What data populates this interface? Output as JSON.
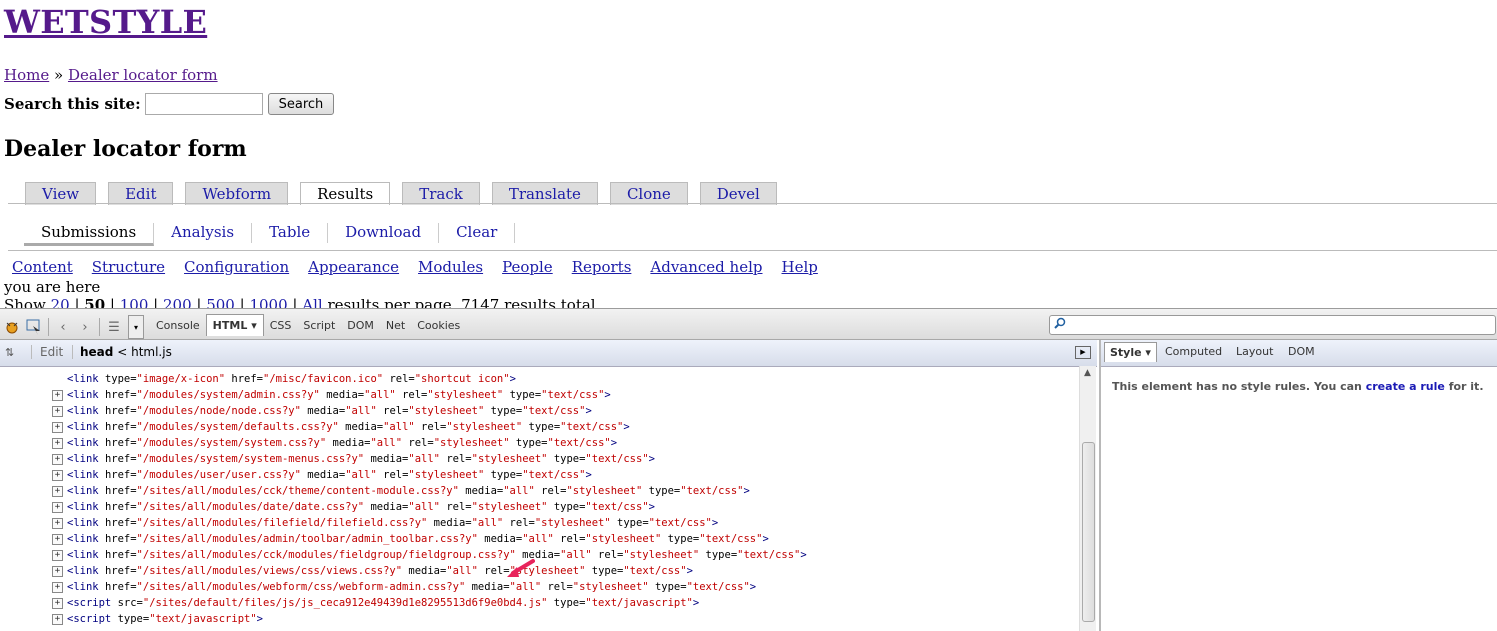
{
  "site": {
    "logo": "WETSTYLE",
    "breadcrumb": {
      "home": "Home",
      "sep": "»",
      "current": "Dealer locator form"
    },
    "search": {
      "label": "Search this site:",
      "value": "",
      "button": "Search"
    },
    "page_title": "Dealer locator form",
    "tabs": [
      "View",
      "Edit",
      "Webform",
      "Results",
      "Track",
      "Translate",
      "Clone",
      "Devel"
    ],
    "subtabs": [
      "Submissions",
      "Analysis",
      "Table",
      "Download",
      "Clear"
    ],
    "admin_menu": [
      "Content",
      "Structure",
      "Configuration",
      "Appearance",
      "Modules",
      "People",
      "Reports",
      "Advanced help",
      "Help"
    ],
    "you_are_here": "you are here",
    "pager": {
      "show": "Show",
      "options": [
        "20",
        "50",
        "100",
        "200",
        "500",
        "1000",
        "All"
      ],
      "suffix": "results per page. 7147 results total"
    }
  },
  "firebug": {
    "panels": [
      "Console",
      "HTML",
      "CSS",
      "Script",
      "DOM",
      "Net",
      "Cookies"
    ],
    "active_panel": "HTML",
    "breadcrumb": {
      "edit": "Edit",
      "current": "head",
      "sep": "<",
      "parent": "html.js"
    },
    "side_tabs": [
      "Style",
      "Computed",
      "Layout",
      "DOM"
    ],
    "side_message": {
      "before": "This element has no style rules. You can ",
      "link": "create a rule",
      "after": " for it."
    },
    "lines": [
      {
        "tag": "link",
        "expand": false,
        "attrs": [
          [
            "type",
            "image/x-icon"
          ],
          [
            "href",
            "/misc/favicon.ico"
          ],
          [
            "rel",
            "shortcut icon"
          ]
        ]
      },
      {
        "tag": "link",
        "expand": true,
        "attrs": [
          [
            "href",
            "/modules/system/admin.css?y"
          ],
          [
            "media",
            "all"
          ],
          [
            "rel",
            "stylesheet"
          ],
          [
            "type",
            "text/css"
          ]
        ]
      },
      {
        "tag": "link",
        "expand": true,
        "attrs": [
          [
            "href",
            "/modules/node/node.css?y"
          ],
          [
            "media",
            "all"
          ],
          [
            "rel",
            "stylesheet"
          ],
          [
            "type",
            "text/css"
          ]
        ]
      },
      {
        "tag": "link",
        "expand": true,
        "attrs": [
          [
            "href",
            "/modules/system/defaults.css?y"
          ],
          [
            "media",
            "all"
          ],
          [
            "rel",
            "stylesheet"
          ],
          [
            "type",
            "text/css"
          ]
        ]
      },
      {
        "tag": "link",
        "expand": true,
        "attrs": [
          [
            "href",
            "/modules/system/system.css?y"
          ],
          [
            "media",
            "all"
          ],
          [
            "rel",
            "stylesheet"
          ],
          [
            "type",
            "text/css"
          ]
        ]
      },
      {
        "tag": "link",
        "expand": true,
        "attrs": [
          [
            "href",
            "/modules/system/system-menus.css?y"
          ],
          [
            "media",
            "all"
          ],
          [
            "rel",
            "stylesheet"
          ],
          [
            "type",
            "text/css"
          ]
        ]
      },
      {
        "tag": "link",
        "expand": true,
        "attrs": [
          [
            "href",
            "/modules/user/user.css?y"
          ],
          [
            "media",
            "all"
          ],
          [
            "rel",
            "stylesheet"
          ],
          [
            "type",
            "text/css"
          ]
        ]
      },
      {
        "tag": "link",
        "expand": true,
        "attrs": [
          [
            "href",
            "/sites/all/modules/cck/theme/content-module.css?y"
          ],
          [
            "media",
            "all"
          ],
          [
            "rel",
            "stylesheet"
          ],
          [
            "type",
            "text/css"
          ]
        ]
      },
      {
        "tag": "link",
        "expand": true,
        "attrs": [
          [
            "href",
            "/sites/all/modules/date/date.css?y"
          ],
          [
            "media",
            "all"
          ],
          [
            "rel",
            "stylesheet"
          ],
          [
            "type",
            "text/css"
          ]
        ]
      },
      {
        "tag": "link",
        "expand": true,
        "attrs": [
          [
            "href",
            "/sites/all/modules/filefield/filefield.css?y"
          ],
          [
            "media",
            "all"
          ],
          [
            "rel",
            "stylesheet"
          ],
          [
            "type",
            "text/css"
          ]
        ]
      },
      {
        "tag": "link",
        "expand": true,
        "attrs": [
          [
            "href",
            "/sites/all/modules/admin/toolbar/admin_toolbar.css?y"
          ],
          [
            "media",
            "all"
          ],
          [
            "rel",
            "stylesheet"
          ],
          [
            "type",
            "text/css"
          ]
        ]
      },
      {
        "tag": "link",
        "expand": true,
        "attrs": [
          [
            "href",
            "/sites/all/modules/cck/modules/fieldgroup/fieldgroup.css?y"
          ],
          [
            "media",
            "all"
          ],
          [
            "rel",
            "stylesheet"
          ],
          [
            "type",
            "text/css"
          ]
        ]
      },
      {
        "tag": "link",
        "expand": true,
        "attrs": [
          [
            "href",
            "/sites/all/modules/views/css/views.css?y"
          ],
          [
            "media",
            "all"
          ],
          [
            "rel",
            "stylesheet"
          ],
          [
            "type",
            "text/css"
          ]
        ]
      },
      {
        "tag": "link",
        "expand": true,
        "attrs": [
          [
            "href",
            "/sites/all/modules/webform/css/webform-admin.css?y"
          ],
          [
            "media",
            "all"
          ],
          [
            "rel",
            "stylesheet"
          ],
          [
            "type",
            "text/css"
          ]
        ]
      },
      {
        "tag": "script",
        "expand": true,
        "attrs": [
          [
            "src",
            "/sites/default/files/js/js_ceca912e49439d1e8295513d6f9e0bd4.js"
          ],
          [
            "type",
            "text/javascript"
          ]
        ]
      },
      {
        "tag": "script",
        "expand": true,
        "attrs": [
          [
            "type",
            "text/javascript"
          ]
        ]
      }
    ]
  },
  "colors": {
    "tag": "#000080",
    "attr_value": "#c00000",
    "link": "#1c1ca8",
    "visited": "#551a8b",
    "highlight_arrow": "#e8245c"
  }
}
